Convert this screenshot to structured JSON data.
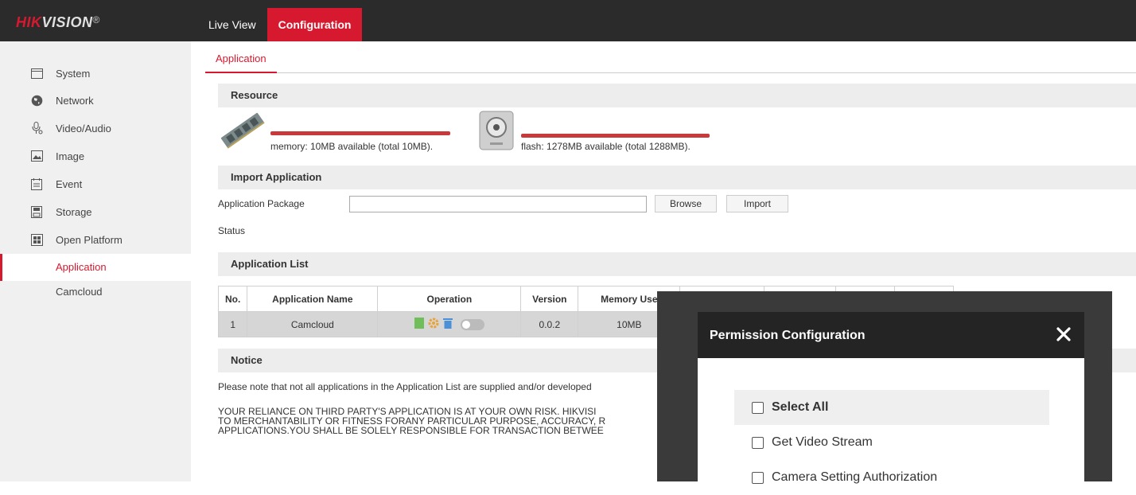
{
  "brand": {
    "red": "HIK",
    "white": "VISION",
    "mark": "®",
    "accent": "#d7192f"
  },
  "topnav": {
    "tabs": [
      {
        "label": "Live View"
      },
      {
        "label": "Configuration"
      }
    ]
  },
  "sidebar": {
    "items": [
      {
        "label": "System",
        "icon": "monitor-icon"
      },
      {
        "label": "Network",
        "icon": "globe-icon"
      },
      {
        "label": "Video/Audio",
        "icon": "microphone-icon"
      },
      {
        "label": "Image",
        "icon": "image-icon"
      },
      {
        "label": "Event",
        "icon": "calendar-icon"
      },
      {
        "label": "Storage",
        "icon": "storage-icon"
      },
      {
        "label": "Open Platform",
        "icon": "platform-icon"
      }
    ],
    "subitems": [
      {
        "label": "Application"
      },
      {
        "label": "Camcloud"
      }
    ]
  },
  "main": {
    "subtab": "Application",
    "resource": {
      "title": "Resource",
      "memory": "memory:  10MB available (total 10MB).",
      "flash": "flash:  1278MB available (total 1288MB)."
    },
    "import": {
      "title": "Import Application",
      "package_label": "Application Package",
      "package_value": "",
      "browse": "Browse",
      "import": "Import",
      "status_label": "Status"
    },
    "list": {
      "title": "Application List",
      "headers": [
        "No.",
        "Application Name",
        "Operation",
        "Version",
        "Memory Use"
      ],
      "rows": [
        {
          "no": "1",
          "name": "Camcloud",
          "version": "0.0.2",
          "memory": "10MB"
        }
      ]
    },
    "notice": {
      "title": "Notice",
      "line1": "Please note that not all applications in the Application List are supplied and/or developed",
      "line2": "YOUR RELIANCE ON THIRD PARTY'S APPLICATION IS AT YOUR OWN RISK. HIKVISI",
      "line3": "TO MERCHANTABILITY OR FITNESS FORANY PARTICULAR PURPOSE, ACCURACY, R",
      "line4": "APPLICATIONS.YOU SHALL BE SOLELY RESPONSIBLE FOR TRANSACTION BETWEE"
    }
  },
  "dialog": {
    "title": "Permission Configuration",
    "options": [
      "Select All",
      "Get Video Stream",
      "Camera Setting Authorization"
    ]
  }
}
